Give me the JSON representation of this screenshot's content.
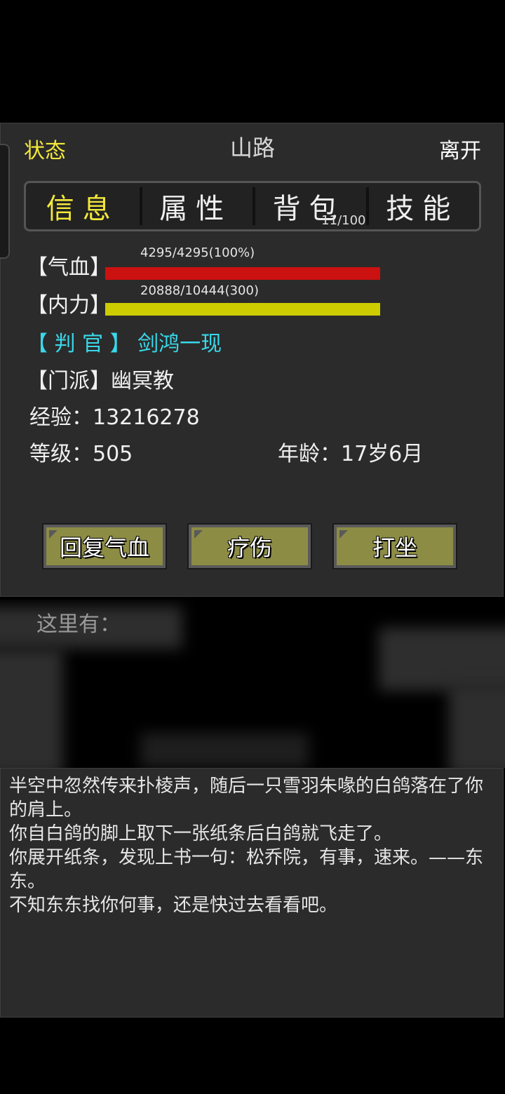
{
  "header": {
    "state_label": "状态",
    "location": "山路",
    "leave_label": "离开"
  },
  "tabs": [
    {
      "label": "信息",
      "active": true
    },
    {
      "label": "属性",
      "active": false
    },
    {
      "label": "背包",
      "active": false,
      "count": "11/100"
    },
    {
      "label": "技能",
      "active": false
    }
  ],
  "stats": {
    "hp_label": "【气血】",
    "hp_text": "4295/4295(100%)",
    "hp_fraction": 1.0,
    "hp_color": "#cc1111",
    "mp_label": "【内力】",
    "mp_text": "20888/10444(300)",
    "mp_fraction": 1.0,
    "mp_color": "#cccc00",
    "title_tag": "【 判  官 】",
    "title_name": "剑鸿一现",
    "sect_label": "【门派】",
    "sect_value": "幽冥教",
    "exp_label": "经验：",
    "exp_value": "13216278",
    "level_label": "等级：",
    "level_value": "505",
    "age_label": "年龄：",
    "age_value": "17岁6月"
  },
  "actions": {
    "restore_hp": "回复气血",
    "heal": "疗伤",
    "meditate": "打坐"
  },
  "here": {
    "label": "这里有："
  },
  "log": [
    "半空中忽然传来扑棱声，随后一只雪羽朱喙的白鸽落在了你的肩上。",
    "你自白鸽的脚上取下一张纸条后白鸽就飞走了。",
    "你展开纸条，发现上书一句：松乔院，有事，速来。——东东。",
    "不知东东找你何事，还是快过去看看吧。"
  ]
}
